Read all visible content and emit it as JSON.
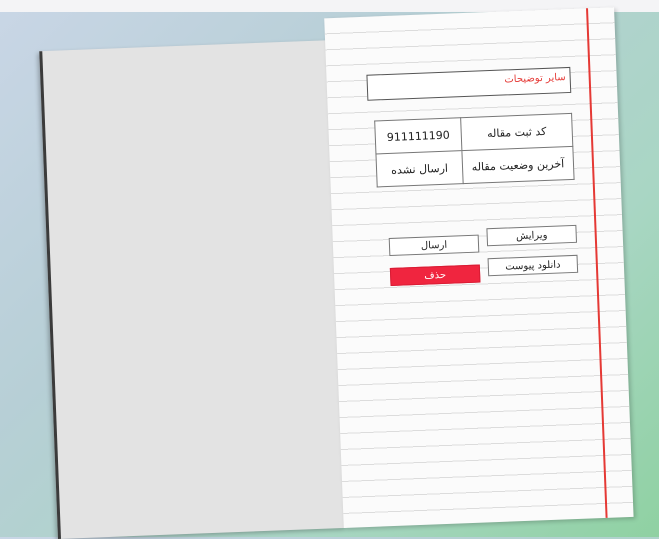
{
  "description_placeholder": "سایر توضیحات",
  "info_table": [
    {
      "key": "کد ثبت مقاله",
      "value": "911111190"
    },
    {
      "key": "آخرین وضعیت مقاله",
      "value": "ارسال نشده"
    }
  ],
  "buttons": {
    "edit": "ویرایش",
    "send": "ارسال",
    "download": "دانلود پیوست",
    "delete": "حذف"
  },
  "colors": {
    "accent_red": "#f0253f",
    "margin_line": "#e53935"
  }
}
